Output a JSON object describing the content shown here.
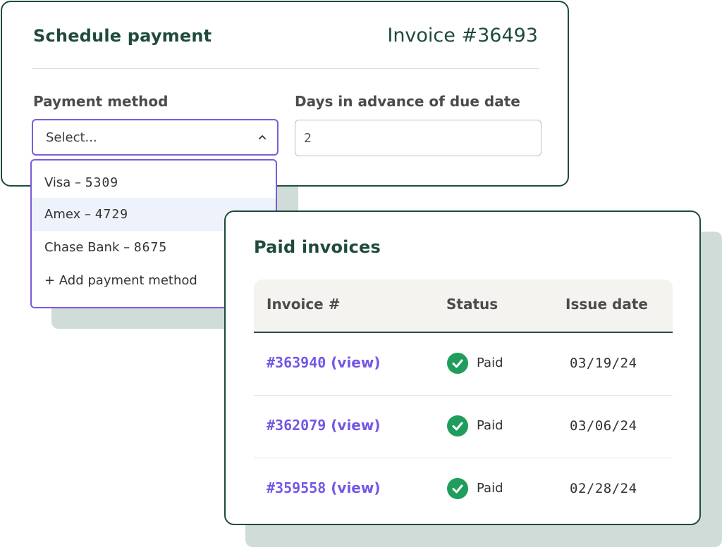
{
  "schedule_payment": {
    "title": "Schedule payment",
    "invoice_number": "Invoice #36493",
    "payment_method_label": "Payment method",
    "payment_method_placeholder": "Select...",
    "days_label": "Days in advance of due date",
    "days_value": "2",
    "dropdown": {
      "options": [
        {
          "name": "Visa – ",
          "digits": "5309"
        },
        {
          "name": "Amex – ",
          "digits": "4729"
        },
        {
          "name": "Chase Bank – ",
          "digits": "8675"
        }
      ],
      "add_label": "+ Add payment method"
    }
  },
  "paid_invoices": {
    "title": "Paid invoices",
    "columns": [
      "Invoice #",
      "Status",
      "Issue date"
    ],
    "rows": [
      {
        "invoice": "#363940",
        "view": "(view)",
        "status": "Paid",
        "date": "03/19/24"
      },
      {
        "invoice": "#362079",
        "view": "(view)",
        "status": "Paid",
        "date": "03/06/24"
      },
      {
        "invoice": "#359558",
        "view": "(view)",
        "status": "Paid",
        "date": "02/28/24"
      }
    ]
  },
  "colors": {
    "brand_green": "#1f4a3e",
    "accent_purple": "#7457e6",
    "status_green": "#1f9d5c"
  }
}
